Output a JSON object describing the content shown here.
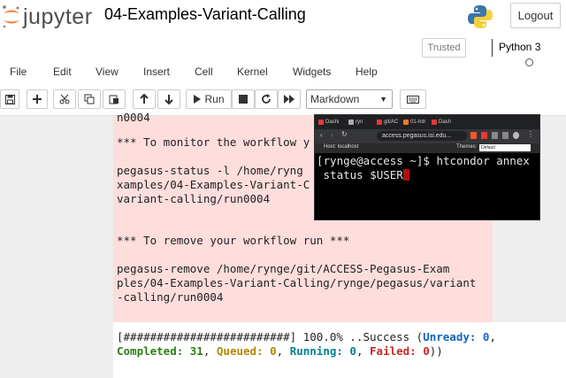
{
  "header": {
    "logo_text": "jupyter",
    "notebook_title": "04-Examples-Variant-Calling",
    "logout_label": "Logout"
  },
  "status": {
    "trusted_label": "Trusted",
    "kernel_name": "Python 3"
  },
  "menu": {
    "items": [
      "File",
      "Edit",
      "View",
      "Insert",
      "Cell",
      "Kernel",
      "Widgets",
      "Help"
    ]
  },
  "toolbar": {
    "run_label": "Run",
    "cell_type": "Markdown"
  },
  "output": {
    "lines": [
      "n0004",
      "",
      "*** To monitor the workflow y",
      "",
      "pegasus-status -l /home/ryng",
      "xamples/04-Examples-Variant-C",
      "variant-calling/run0004",
      "",
      "",
      "*** To remove your workflow run ***",
      "",
      "pegasus-remove /home/rynge/git/ACCESS-Pegasus-Exam",
      "ples/04-Examples-Variant-Calling/rynge/pegasus/variant",
      "-calling/run0004"
    ],
    "progress": "[#########################] 100.0% ..Success (",
    "unready_label": "Unready: 0",
    "completed_label": "Completed: 31",
    "queued_label": "Queued: 0",
    "running_label": "Running: 0",
    "failed_label": "Failed: 0"
  },
  "browser": {
    "tabs": [
      "Dashi",
      "ryn",
      "git/AC",
      "01-Intr",
      "Dash"
    ],
    "url": "access.pegasus.isi.edu...",
    "host_label": "Host: localhost",
    "theme_label": "Themes:",
    "theme_value": "Default",
    "terminal_line1": "[rynge@access ~]$ htcondor annex",
    "terminal_line2": " status $USER"
  },
  "colors": {
    "output_bg": "#fedddd",
    "notebook_bg": "#eeeeee",
    "jupyter_orange": "#f37726"
  }
}
